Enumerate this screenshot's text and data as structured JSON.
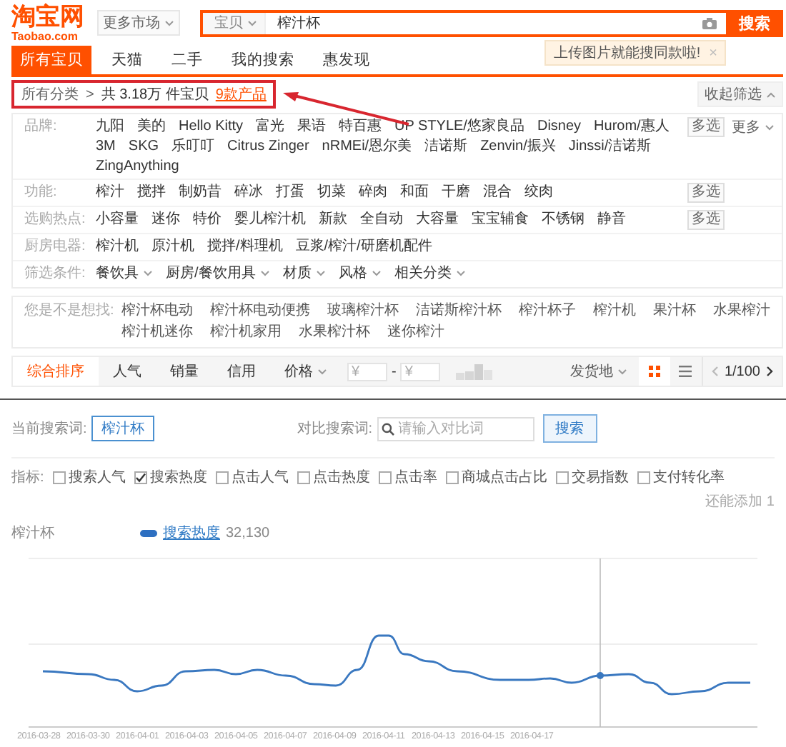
{
  "header": {
    "logo": "淘宝网",
    "domain": "Taobao.com",
    "market": "更多市场",
    "search": {
      "scope": "宝贝",
      "value": "榨汁杯",
      "button": "搜索"
    },
    "tooltip": {
      "text": "上传图片就能搜同款啦!",
      "close": "×"
    }
  },
  "tabs": [
    {
      "label": "所有宝贝",
      "selected": true
    },
    {
      "label": "天猫",
      "selected": false
    },
    {
      "label": "二手",
      "selected": false
    },
    {
      "label": "我的搜索",
      "selected": false
    },
    {
      "label": "惠发现",
      "selected": false
    }
  ],
  "breadcrumb": {
    "root": "所有分类",
    "separator": ">",
    "count": "共 3.18万 件宝贝",
    "products": "9款产品",
    "annotated": true,
    "collapse": "收起筛选"
  },
  "filters": [
    {
      "label": "品牌:",
      "options": [
        "九阳",
        "美的",
        "Hello Kitty",
        "富光",
        "果语",
        "特百惠",
        "UP STYLE/悠家良品",
        "Disney",
        "Hurom/惠人",
        "3M",
        "SKG",
        "乐叮叮",
        "Citrus Zinger",
        "nRMEi/恩尔美",
        "洁诺斯",
        "Zenvin/振兴",
        "Jinssi/洁诺斯",
        "ZingAnything"
      ],
      "multi": "多选",
      "more": "更多"
    },
    {
      "label": "功能:",
      "options": [
        "榨汁",
        "搅拌",
        "制奶昔",
        "碎冰",
        "打蛋",
        "切菜",
        "碎肉",
        "和面",
        "干磨",
        "混合",
        "绞肉"
      ],
      "multi": "多选"
    },
    {
      "label": "选购热点:",
      "options": [
        "小容量",
        "迷你",
        "特价",
        "婴儿榨汁机",
        "新款",
        "全自动",
        "大容量",
        "宝宝辅食",
        "不锈钢",
        "静音"
      ],
      "multi": "多选"
    },
    {
      "label": "厨房电器:",
      "options": [
        "榨汁机",
        "原汁机",
        "搅拌/料理机",
        "豆浆/榨汁/研磨机配件"
      ]
    }
  ],
  "conditions": {
    "label": "筛选条件:",
    "dropdowns": [
      "餐饮具",
      "厨房/餐饮用具",
      "材质",
      "风格",
      "相关分类"
    ]
  },
  "suggestions": {
    "label": "您是不是想找:",
    "items": [
      "榨汁杯电动",
      "榨汁杯电动便携",
      "玻璃榨汁杯",
      "洁诺斯榨汁杯",
      "榨汁杯子",
      "榨汁机",
      "果汁杯",
      "水果榨汁",
      "榨汁机迷你",
      "榨汁机家用",
      "水果榨汁杯",
      "迷你榨汁"
    ]
  },
  "sort_bar": {
    "options": [
      {
        "label": "综合排序",
        "selected": true
      },
      {
        "label": "人气",
        "selected": false
      },
      {
        "label": "销量",
        "selected": false
      },
      {
        "label": "信用",
        "selected": false
      }
    ],
    "price": "价格",
    "price_from": {
      "placeholder": "¥"
    },
    "price_separator": "-",
    "price_to": {
      "placeholder": "¥"
    },
    "location": "发货地",
    "views": [
      {
        "kind": "grid",
        "selected": true
      },
      {
        "kind": "list",
        "selected": false
      }
    ],
    "page": "1/100"
  },
  "trend": {
    "current_label": "当前搜索词:",
    "current_term": "榨汁杯",
    "compare_label": "对比搜索词:",
    "compare_placeholder": "请输入对比词",
    "compare_button": "搜索",
    "metrics_label": "指标:",
    "metrics": [
      {
        "label": "搜索人气",
        "checked": false
      },
      {
        "label": "搜索热度",
        "checked": true
      },
      {
        "label": "点击人气",
        "checked": false
      },
      {
        "label": "点击热度",
        "checked": false
      },
      {
        "label": "点击率",
        "checked": false
      },
      {
        "label": "商城点击占比",
        "checked": false
      },
      {
        "label": "交易指数",
        "checked": false
      },
      {
        "label": "支付转化率",
        "checked": false
      }
    ],
    "remaining": "还能添加 1",
    "series_term": "榨汁杯",
    "legend": {
      "name": "搜索热度",
      "value": "32,130"
    },
    "dates": [
      "2016-03-28",
      "2016-03-30",
      "2016-04-01",
      "2016-04-03",
      "2016-04-05",
      "2016-04-07",
      "2016-04-09",
      "2016-04-11",
      "2016-04-13",
      "2016-04-15",
      "2016-04-17"
    ]
  }
}
